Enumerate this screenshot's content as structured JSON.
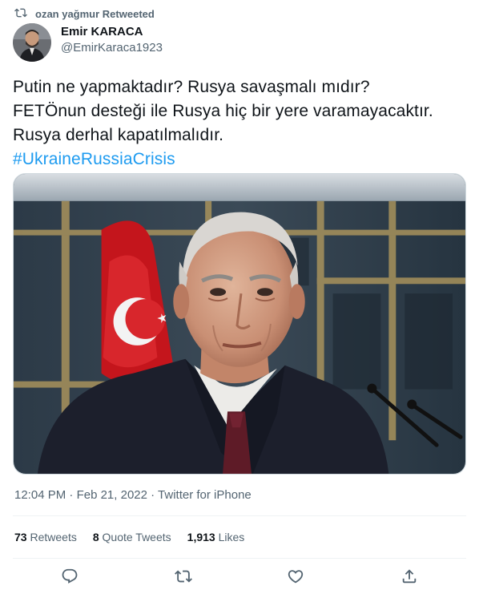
{
  "retweet_context": {
    "icon": "retweet-icon",
    "text": "ozan yağmur Retweeted"
  },
  "author": {
    "display_name": "Emir KARACA",
    "handle": "@EmirKaraca1923",
    "avatar": "avatar-photo"
  },
  "tweet": {
    "lines": [
      "Putin ne yapmaktadır? Rusya savaşmalı mıdır?",
      "FETÖnun desteği ile Rusya hiç bir yere varamayacaktır.",
      "Rusya derhal kapatılmalıdır."
    ],
    "hashtag": "#UkraineRussiaCrisis",
    "media": "photo-elderly-man-suit-flag-background"
  },
  "meta": {
    "time": "12:04 PM",
    "separator": " · ",
    "date": "Feb 21, 2022",
    "source": "Twitter for iPhone"
  },
  "stats": {
    "retweets_count": "73",
    "retweets_label": "Retweets",
    "quotes_count": "8",
    "quotes_label": "Quote Tweets",
    "likes_count": "1,913",
    "likes_label": "Likes"
  },
  "actions": {
    "reply": "reply-icon",
    "retweet": "retweet-icon",
    "like": "heart-icon",
    "share": "share-icon"
  },
  "colors": {
    "link": "#1d9bf0",
    "secondary_text": "#536471",
    "primary_text": "#0f1419",
    "divider": "#eff3f4"
  }
}
